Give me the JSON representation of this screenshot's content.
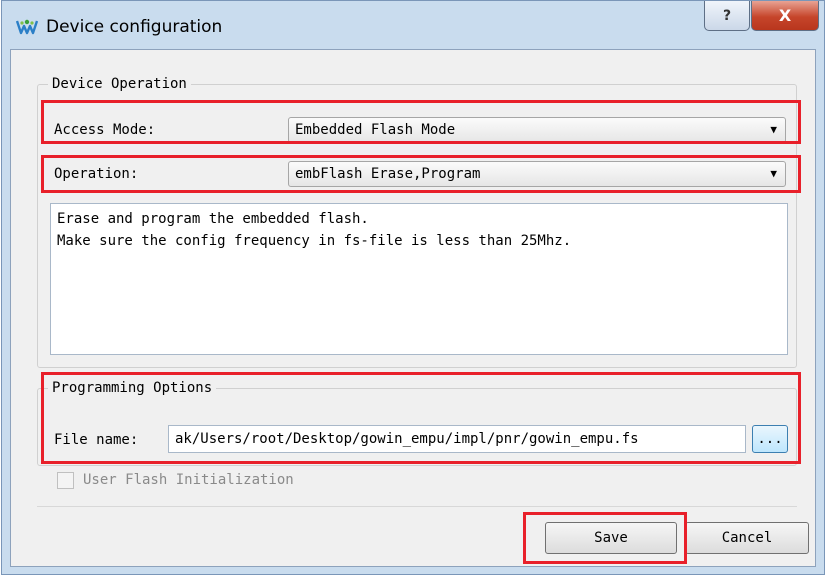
{
  "window": {
    "title": "Device configuration",
    "help_label": "?",
    "close_label": "X"
  },
  "device_operation": {
    "legend": "Device Operation",
    "access_mode_label": "Access Mode:",
    "access_mode_value": "Embedded Flash Mode",
    "operation_label": "Operation:",
    "operation_value": "embFlash Erase,Program",
    "description_line1": "Erase and program the embedded flash.",
    "description_line2": "Make sure the config frequency in fs-file is less than 25Mhz."
  },
  "programming_options": {
    "legend": "Programming Options",
    "file_name_label": "File name:",
    "file_name_value": "ak/Users/root/Desktop/gowin_empu/impl/pnr/gowin_empu.fs",
    "browse_label": "...",
    "user_flash_label": "User Flash Initialization",
    "user_flash_checked": false
  },
  "footer": {
    "save_label": "Save",
    "cancel_label": "Cancel"
  },
  "icons": {
    "app": "gowin-logo-icon",
    "dropdown": "chevron-down-icon"
  },
  "colors": {
    "highlight": "#e8202a",
    "title_bar": "#c9dcee",
    "close_button": "#c6452b"
  }
}
